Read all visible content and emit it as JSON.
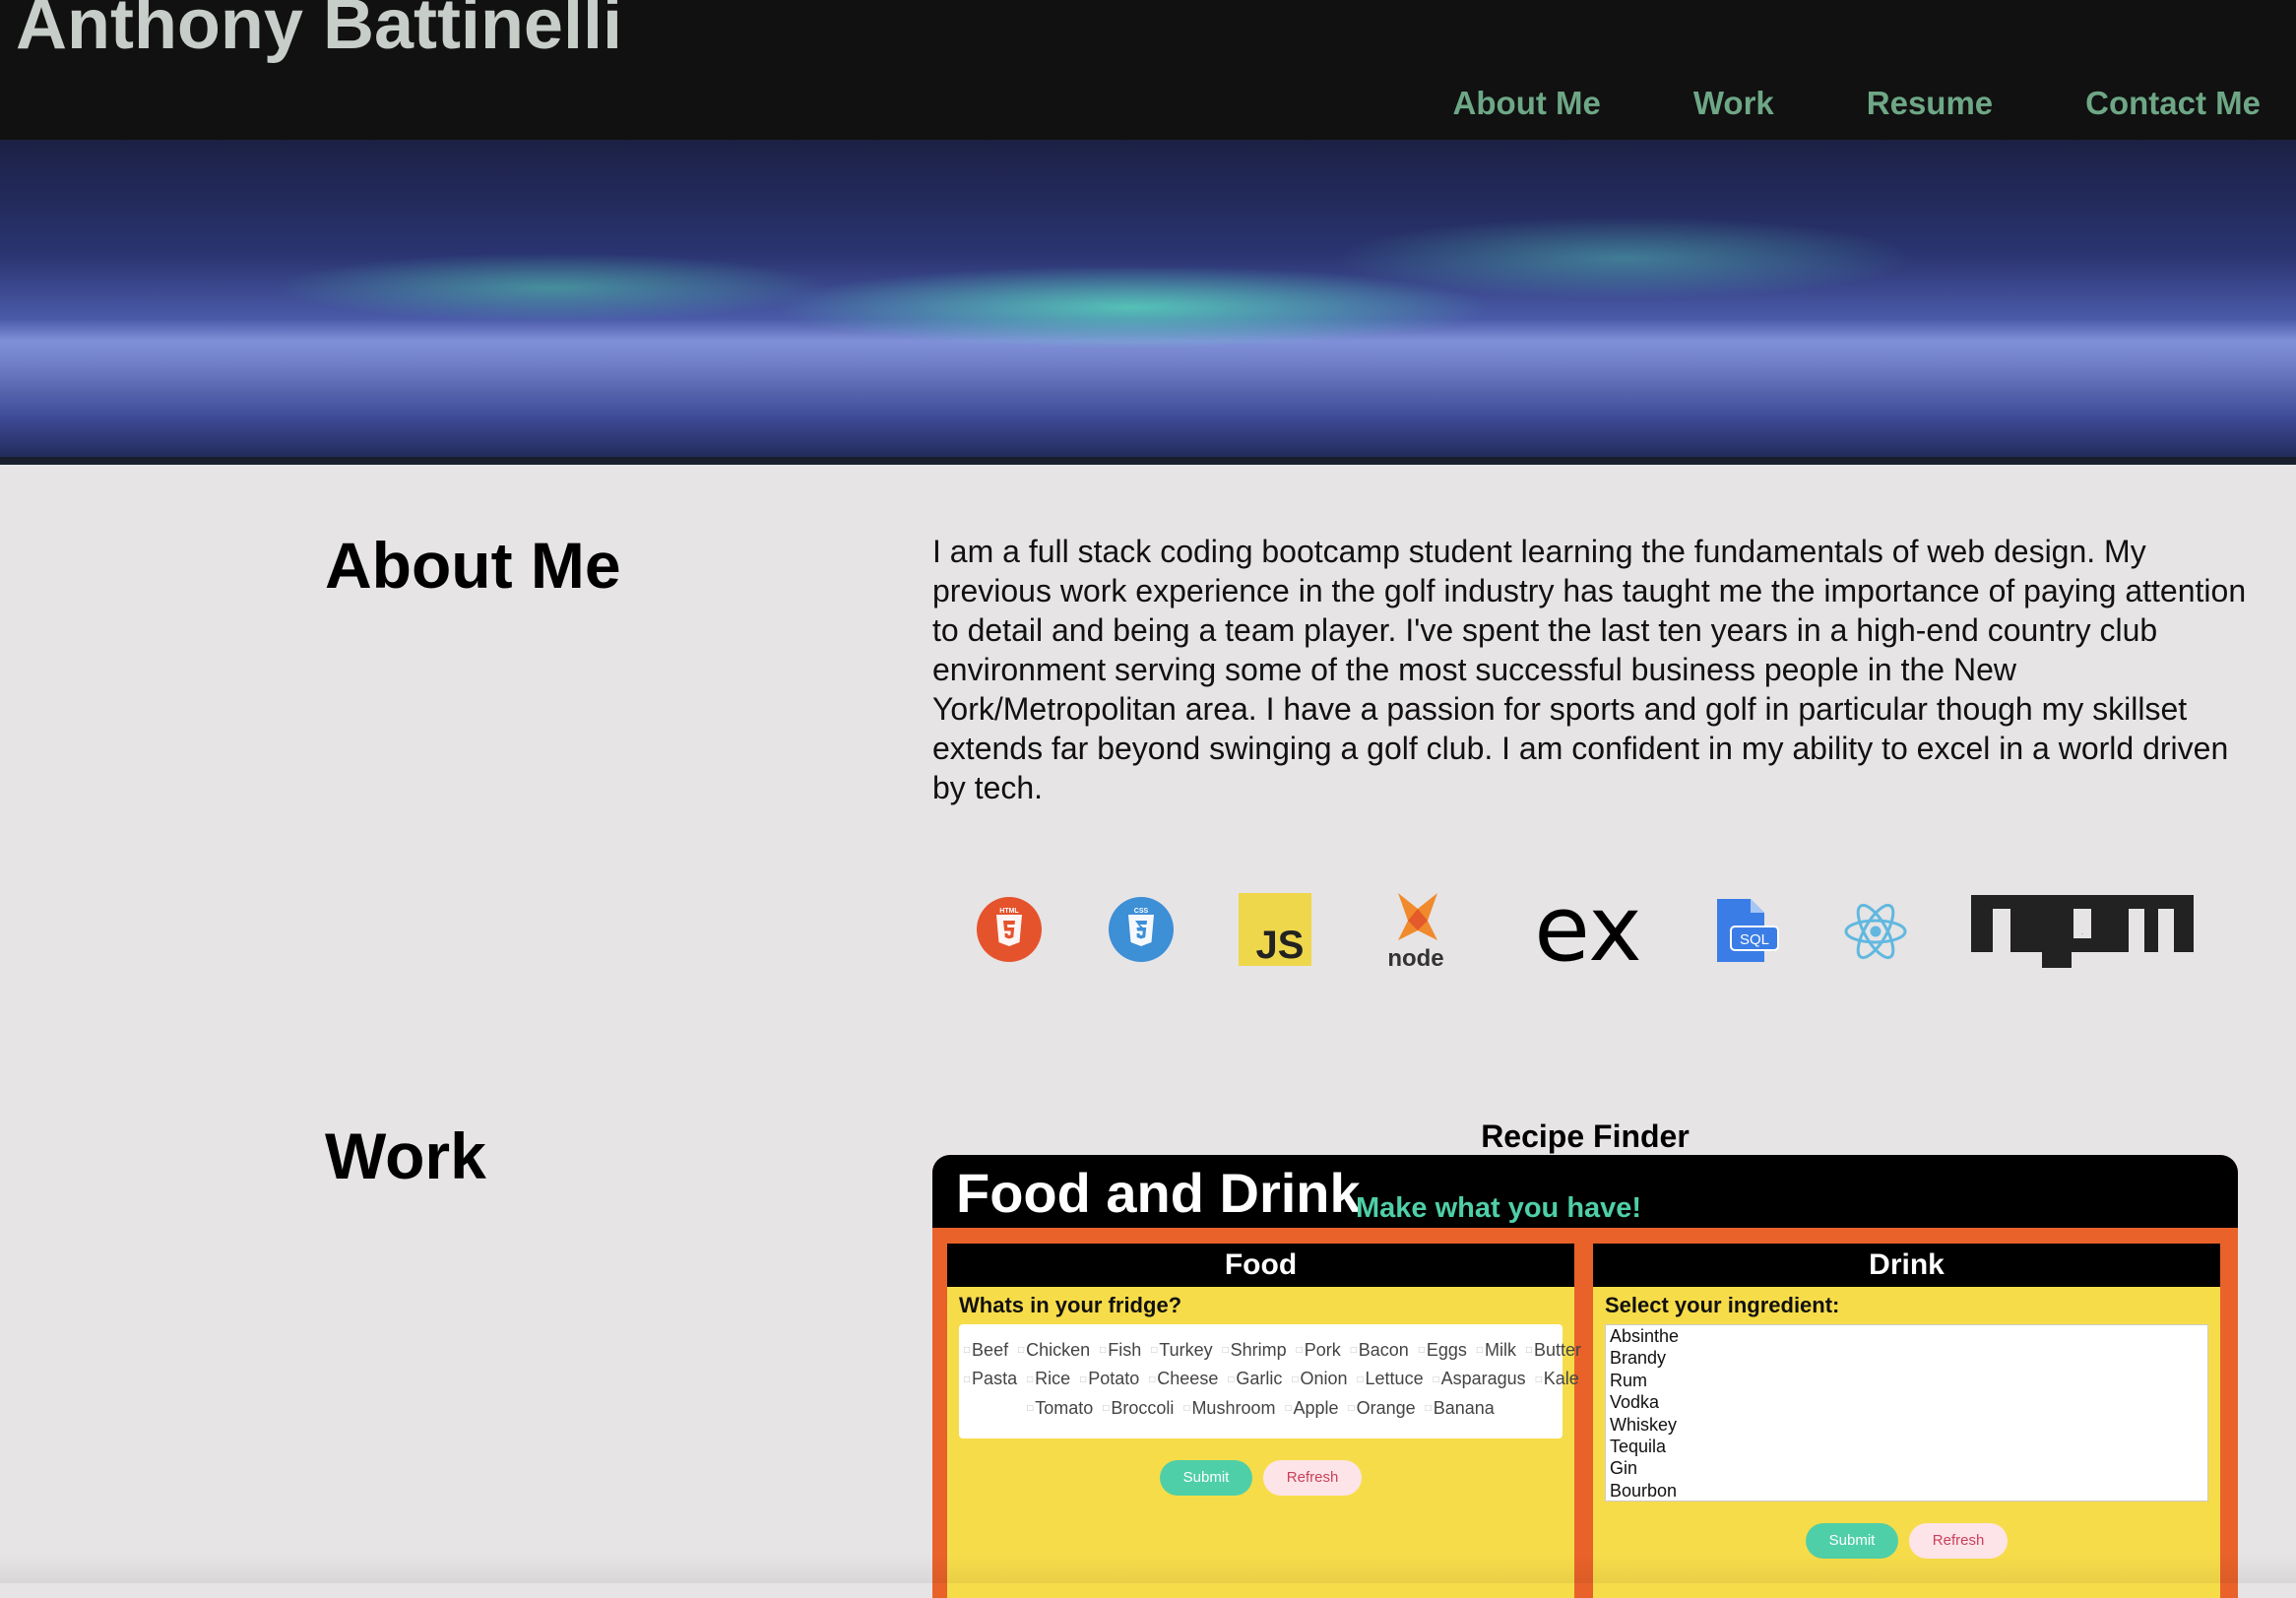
{
  "header": {
    "title": "Anthony Battinelli",
    "nav": [
      "About Me",
      "Work",
      "Resume",
      "Contact Me"
    ]
  },
  "about": {
    "heading": "About Me",
    "text": "I am a full stack coding bootcamp student learning the fundamentals of web design. My previous work experience in the golf industry has taught me the importance of paying attention to detail and being a team player. I've spent the last ten years in a high-end country club environment serving some of the most successful business people in the New York/Metropolitan area. I have a passion for sports and golf in particular though my skillset extends far beyond swinging a golf club. I am confident in my ability to excel in a world driven by tech.",
    "icons": [
      {
        "name": "html5-icon",
        "label": "HTML"
      },
      {
        "name": "css3-icon",
        "label": "CSS"
      },
      {
        "name": "javascript-icon",
        "label": "JS"
      },
      {
        "name": "nodejs-icon",
        "label": "node"
      },
      {
        "name": "express-icon",
        "label": "ex"
      },
      {
        "name": "sql-icon",
        "label": "SQL"
      },
      {
        "name": "react-icon",
        "label": ""
      },
      {
        "name": "npm-icon",
        "label": "npm"
      }
    ]
  },
  "work": {
    "heading": "Work",
    "project_title": "Recipe Finder",
    "app": {
      "title": "Food and Drink",
      "tagline": "Make what you have!",
      "food": {
        "heading": "Food",
        "question": "Whats in your fridge?",
        "rows": [
          [
            "Beef",
            "Chicken",
            "Fish",
            "Turkey",
            "Shrimp",
            "Pork",
            "Bacon",
            "Eggs",
            "Milk",
            "Butter"
          ],
          [
            "Pasta",
            "Rice",
            "Potato",
            "Cheese",
            "Garlic",
            "Onion",
            "Lettuce",
            "Asparagus",
            "Kale"
          ],
          [
            "Tomato",
            "Broccoli",
            "Mushroom",
            "Apple",
            "Orange",
            "Banana"
          ]
        ],
        "submit": "Submit",
        "refresh": "Refresh"
      },
      "drink": {
        "heading": "Drink",
        "question": "Select your ingredient:",
        "options": [
          "Absinthe",
          "Brandy",
          "Rum",
          "Vodka",
          "Whiskey",
          "Tequila",
          "Gin",
          "Bourbon"
        ],
        "submit": "Submit",
        "refresh": "Refresh"
      }
    }
  }
}
